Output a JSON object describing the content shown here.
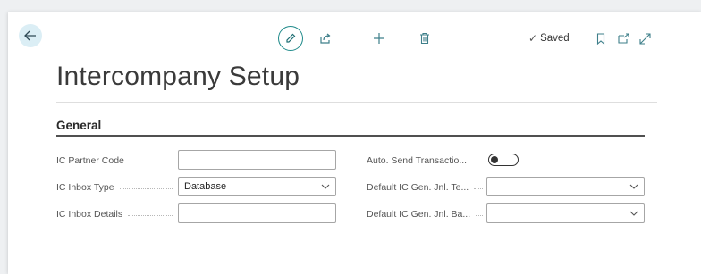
{
  "header": {
    "title": "Intercompany Setup",
    "saved_label": "Saved",
    "icons": {
      "back": "arrow-left-icon",
      "edit": "pencil-icon",
      "share": "share-icon",
      "new": "plus-icon",
      "delete": "trash-icon",
      "bookmark": "bookmark-icon",
      "open_new": "open-in-new-window-icon",
      "expand": "expand-icon"
    }
  },
  "general": {
    "section_title": "General",
    "left_fields": [
      {
        "label": "IC Partner Code",
        "value": ""
      },
      {
        "label": "IC Inbox Type",
        "value": "Database"
      },
      {
        "label": "IC Inbox Details",
        "value": ""
      }
    ],
    "right_fields": [
      {
        "label": "Auto. Send Transactio...",
        "value": "off"
      },
      {
        "label": "Default IC Gen. Jnl. Te...",
        "value": ""
      },
      {
        "label": "Default IC Gen. Jnl. Ba...",
        "value": ""
      }
    ]
  },
  "colors": {
    "accent": "#1f8a8a",
    "background": "#eef0f2",
    "card": "#ffffff"
  }
}
